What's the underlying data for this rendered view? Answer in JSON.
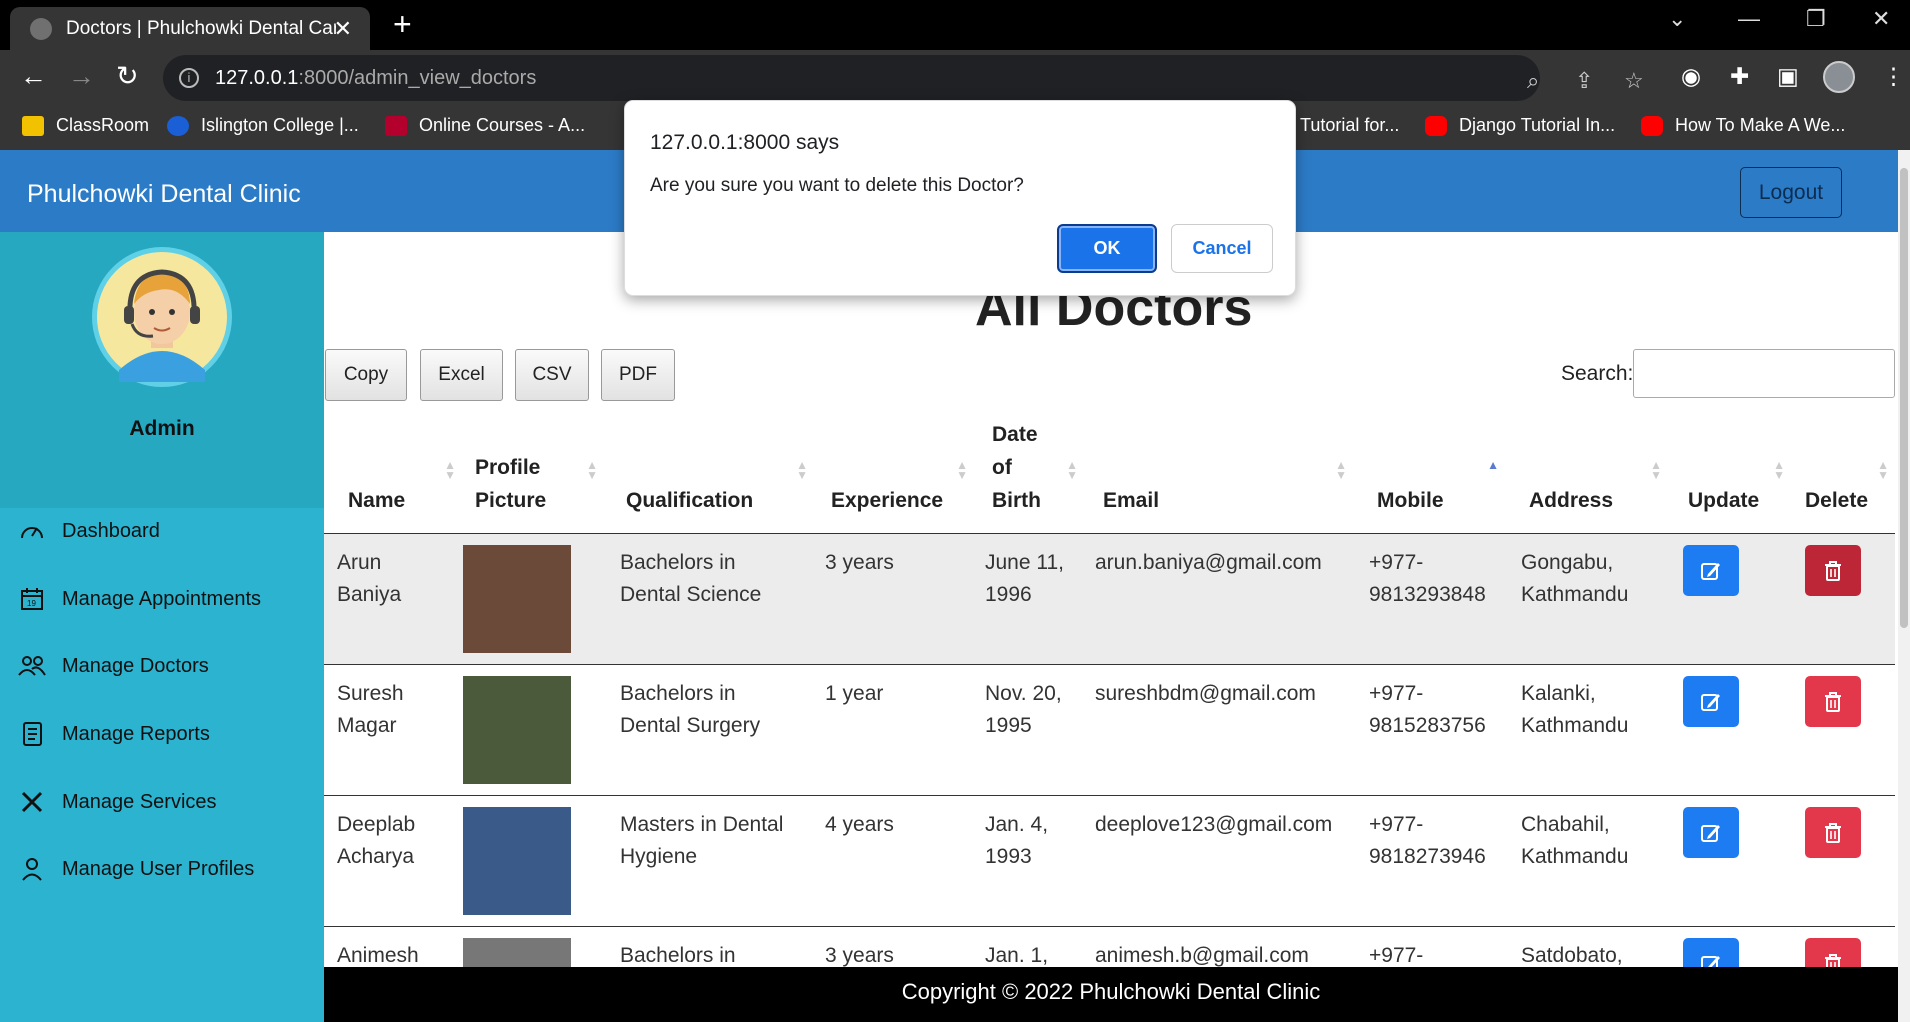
{
  "browser": {
    "tab_title": "Doctors | Phulchowki Dental Care",
    "url_host": "127.0.0.1",
    "url_path": ":8000/admin_view_doctors",
    "bookmarks": [
      "ClassRoom",
      "Islington College |...",
      "Online Courses - A...",
      "Tutorial for...",
      "Django Tutorial In...",
      "How To Make A We..."
    ]
  },
  "app": {
    "brand": "Phulchowki Dental Clinic",
    "logout_label": "Logout",
    "user_name": "Admin",
    "menu": [
      "Dashboard",
      "Manage Appointments",
      "Manage Doctors",
      "Manage Reports",
      "Manage Services",
      "Manage User Profiles"
    ],
    "page_title": "All Doctors",
    "export_buttons": [
      "Copy",
      "Excel",
      "CSV",
      "PDF"
    ],
    "search_label": "Search:",
    "search_value": "",
    "columns": [
      "Name",
      "Profile Picture",
      "Qualification",
      "Experience",
      "Date of Birth",
      "Email",
      "Mobile",
      "Address",
      "Update",
      "Delete"
    ],
    "rows": [
      {
        "name": "Arun Baniya",
        "qualification": "Bachelors in Dental Science",
        "experience": "3 years",
        "dob": "June 11, 1996",
        "email": "arun.baniya@gmail.com",
        "mobile": "+977-9813293848",
        "address": "Gongabu, Kathmandu"
      },
      {
        "name": "Suresh Magar",
        "qualification": "Bachelors in Dental Surgery",
        "experience": "1 year",
        "dob": "Nov. 20, 1995",
        "email": "sureshbdm@gmail.com",
        "mobile": "+977-9815283756",
        "address": "Kalanki, Kathmandu"
      },
      {
        "name": "Deeplab Acharya",
        "qualification": "Masters in Dental Hygiene",
        "experience": "4 years",
        "dob": "Jan. 4, 1993",
        "email": "deeplove123@gmail.com",
        "mobile": "+977-9818273946",
        "address": "Chabahil, Kathmandu"
      },
      {
        "name": "Animesh",
        "qualification": "Bachelors in",
        "experience": "3 years",
        "dob": "Jan. 1,",
        "email": "animesh.b@gmail.com",
        "mobile": "+977-",
        "address": "Satdobato,"
      }
    ],
    "footer": "Copyright © 2022 Phulchowki Dental Clinic"
  },
  "dialog": {
    "title": "127.0.0.1:8000 says",
    "message": "Are you sure you want to delete this Doctor?",
    "ok_label": "OK",
    "cancel_label": "Cancel"
  },
  "colors": {
    "navbar": "#2c7bc7",
    "sidebar": "#2bb3d0",
    "update": "#1d7cf2",
    "delete": "#e3374c"
  }
}
